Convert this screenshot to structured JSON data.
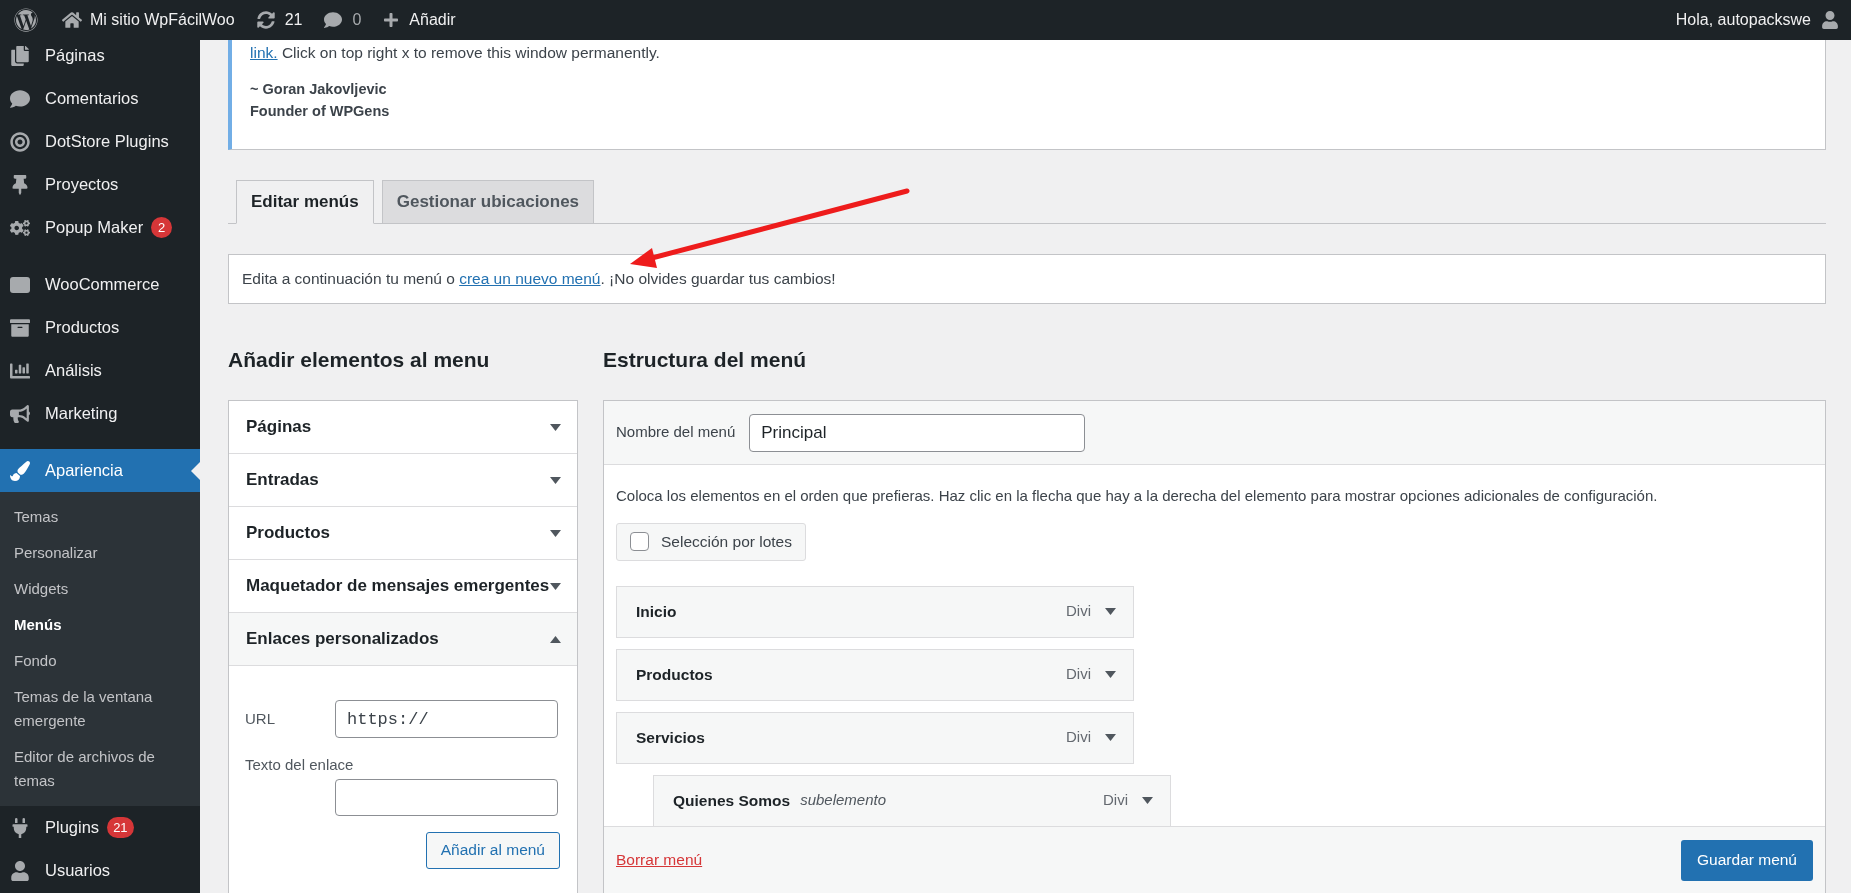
{
  "admin_bar": {
    "site_name": "Mi sitio WpFácilWoo",
    "updates_count": "21",
    "comments_count": "0",
    "new_label": "Añadir",
    "greeting": "Hola, autopackswe"
  },
  "sidebar": {
    "groups": [
      [
        {
          "label": "Páginas",
          "selected": false
        },
        {
          "label": "Comentarios",
          "selected": false
        },
        {
          "label": "DotStore Plugins",
          "selected": false
        },
        {
          "label": "Proyectos",
          "selected": false
        },
        {
          "label": "Popup Maker",
          "badge": "2",
          "selected": false
        }
      ],
      [
        {
          "label": "WooCommerce",
          "selected": false
        },
        {
          "label": "Productos",
          "selected": false
        },
        {
          "label": "Análisis",
          "selected": false
        },
        {
          "label": "Marketing",
          "selected": false
        }
      ],
      [
        {
          "label": "Apariencia",
          "selected": true,
          "children": [
            {
              "label": "Temas",
              "selected": false
            },
            {
              "label": "Personalizar",
              "selected": false
            },
            {
              "label": "Widgets",
              "selected": false
            },
            {
              "label": "Menús",
              "selected": true
            },
            {
              "label": "Fondo",
              "selected": false
            },
            {
              "label": "Temas de la ventana emergente",
              "selected": false
            },
            {
              "label": "Editor de archivos de temas",
              "selected": false
            }
          ]
        },
        {
          "label": "Plugins",
          "badge": "21",
          "selected": false
        },
        {
          "label": "Usuarios",
          "selected": false
        }
      ]
    ]
  },
  "notice": {
    "link": "link.",
    "text": " Click on top right x to remove this window permanently.",
    "signature": "~ Goran Jakovljevic",
    "role": "Founder of WPGens"
  },
  "tabs": [
    {
      "label": "Editar menús",
      "selected": true
    },
    {
      "label": "Gestionar ubicaciones",
      "selected": false
    }
  ],
  "info": {
    "before": "Edita a continuación tu menú o ",
    "link": "crea un nuevo menú",
    "after": ". ¡No olvides guardar tus cambios!"
  },
  "add_items": {
    "heading": "Añadir elementos al menu",
    "sections": [
      {
        "title": "Páginas",
        "expanded": false
      },
      {
        "title": "Entradas",
        "expanded": false
      },
      {
        "title": "Productos",
        "expanded": false
      },
      {
        "title": "Maquetador de mensajes emergentes",
        "expanded": false
      },
      {
        "title": "Enlaces personalizados",
        "expanded": true
      }
    ],
    "url_label": "URL",
    "url_value": "https://",
    "link_text_label": "Texto del enlace",
    "add_button": "Añadir al menú"
  },
  "structure": {
    "heading": "Estructura del menú",
    "name_label": "Nombre del menú",
    "name_value": "Principal",
    "instructions": "Coloca los elementos en el orden que prefieras. Haz clic en la flecha que hay a la derecha del elemento para mostrar opciones adicionales de configuración.",
    "bulk_select": {
      "label": "Selección por lotes",
      "checked": false
    },
    "items": [
      {
        "title": "Inicio",
        "type": "Divi"
      },
      {
        "title": "Productos",
        "type": "Divi"
      },
      {
        "title": "Servicios",
        "type": "Divi",
        "children": [
          {
            "title": "Quienes Somos",
            "subtitle": "subelemento",
            "type": "Divi"
          }
        ]
      }
    ],
    "delete_link": "Borrar menú",
    "save_button": "Guardar menú"
  }
}
